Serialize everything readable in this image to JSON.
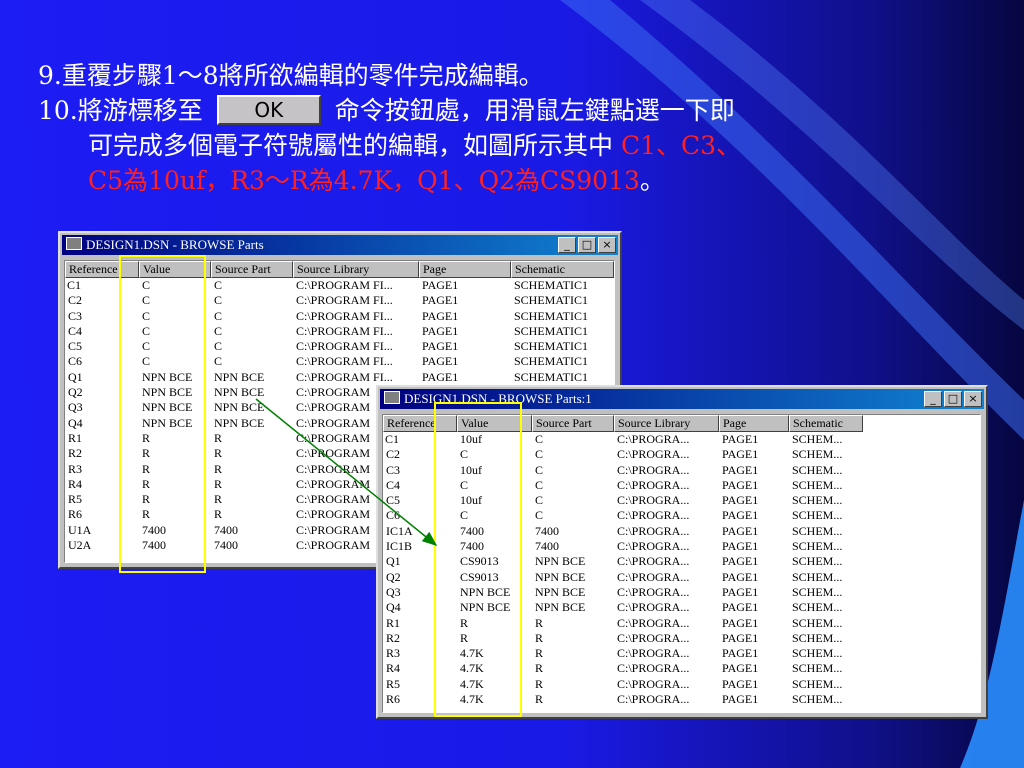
{
  "slide": {
    "line1": "9.重覆步驟1～8將所欲編輯的零件完成編輯。",
    "line2_pre": "10.將游標移至",
    "ok_button": "OK",
    "line2_post": "命令按鈕處，用滑鼠左鍵點選一下即",
    "line3_plain": "可完成多個電子符號屬性的編輯，如圖所示其中",
    "line3_red": "C1、C3、",
    "line4_red": "C5為10uf，R3～R為4.7K，Q1、Q2為CS9013",
    "line4_end": "。"
  },
  "window1": {
    "title": "DESIGN1.DSN - BROWSE Parts",
    "controls": [
      "_",
      "□",
      "×"
    ],
    "columns": [
      "Reference",
      "Value",
      "Source Part",
      "Source Library",
      "Page",
      "Schematic"
    ],
    "rows": [
      [
        "C1",
        "C",
        "C",
        "C:\\PROGRAM FI...",
        "PAGE1",
        "SCHEMATIC1"
      ],
      [
        "C2",
        "C",
        "C",
        "C:\\PROGRAM FI...",
        "PAGE1",
        "SCHEMATIC1"
      ],
      [
        "C3",
        "C",
        "C",
        "C:\\PROGRAM FI...",
        "PAGE1",
        "SCHEMATIC1"
      ],
      [
        "C4",
        "C",
        "C",
        "C:\\PROGRAM FI...",
        "PAGE1",
        "SCHEMATIC1"
      ],
      [
        "C5",
        "C",
        "C",
        "C:\\PROGRAM FI...",
        "PAGE1",
        "SCHEMATIC1"
      ],
      [
        "C6",
        "C",
        "C",
        "C:\\PROGRAM FI...",
        "PAGE1",
        "SCHEMATIC1"
      ],
      [
        "Q1",
        "NPN BCE",
        "NPN BCE",
        "C:\\PROGRAM FI...",
        "PAGE1",
        "SCHEMATIC1"
      ],
      [
        "Q2",
        "NPN BCE",
        "NPN BCE",
        "C:\\PROGRAM",
        "",
        ""
      ],
      [
        "Q3",
        "NPN BCE",
        "NPN BCE",
        "C:\\PROGRAM",
        "",
        ""
      ],
      [
        "Q4",
        "NPN BCE",
        "NPN BCE",
        "C:\\PROGRAM",
        "",
        ""
      ],
      [
        "R1",
        "R",
        "R",
        "C:\\PROGRAM",
        "",
        ""
      ],
      [
        "R2",
        "R",
        "R",
        "C:\\PROGRAM",
        "",
        ""
      ],
      [
        "R3",
        "R",
        "R",
        "C:\\PROGRAM",
        "",
        ""
      ],
      [
        "R4",
        "R",
        "R",
        "C:\\PROGRAM",
        "",
        ""
      ],
      [
        "R5",
        "R",
        "R",
        "C:\\PROGRAM",
        "",
        ""
      ],
      [
        "R6",
        "R",
        "R",
        "C:\\PROGRAM",
        "",
        ""
      ],
      [
        "U1A",
        "7400",
        "7400",
        "C:\\PROGRAM",
        "",
        ""
      ],
      [
        "U2A",
        "7400",
        "7400",
        "C:\\PROGRAM",
        "",
        ""
      ]
    ]
  },
  "window2": {
    "title": "DESIGN1.DSN - BROWSE Parts:1",
    "controls": [
      "_",
      "□",
      "×"
    ],
    "columns": [
      "Reference",
      "Value",
      "Source Part",
      "Source Library",
      "Page",
      "Schematic"
    ],
    "rows": [
      [
        "C1",
        "10uf",
        "C",
        "C:\\PROGRA...",
        "PAGE1",
        "SCHEM..."
      ],
      [
        "C2",
        "C",
        "C",
        "C:\\PROGRA...",
        "PAGE1",
        "SCHEM..."
      ],
      [
        "C3",
        "10uf",
        "C",
        "C:\\PROGRA...",
        "PAGE1",
        "SCHEM..."
      ],
      [
        "C4",
        "C",
        "C",
        "C:\\PROGRA...",
        "PAGE1",
        "SCHEM..."
      ],
      [
        "C5",
        "10uf",
        "C",
        "C:\\PROGRA...",
        "PAGE1",
        "SCHEM..."
      ],
      [
        "C6",
        "C",
        "C",
        "C:\\PROGRA...",
        "PAGE1",
        "SCHEM..."
      ],
      [
        "IC1A",
        "7400",
        "7400",
        "C:\\PROGRA...",
        "PAGE1",
        "SCHEM..."
      ],
      [
        "IC1B",
        "7400",
        "7400",
        "C:\\PROGRA...",
        "PAGE1",
        "SCHEM..."
      ],
      [
        "Q1",
        "CS9013",
        "NPN BCE",
        "C:\\PROGRA...",
        "PAGE1",
        "SCHEM..."
      ],
      [
        "Q2",
        "CS9013",
        "NPN BCE",
        "C:\\PROGRA...",
        "PAGE1",
        "SCHEM..."
      ],
      [
        "Q3",
        "NPN BCE",
        "NPN BCE",
        "C:\\PROGRA...",
        "PAGE1",
        "SCHEM..."
      ],
      [
        "Q4",
        "NPN BCE",
        "NPN BCE",
        "C:\\PROGRA...",
        "PAGE1",
        "SCHEM..."
      ],
      [
        "R1",
        "R",
        "R",
        "C:\\PROGRA...",
        "PAGE1",
        "SCHEM..."
      ],
      [
        "R2",
        "R",
        "R",
        "C:\\PROGRA...",
        "PAGE1",
        "SCHEM..."
      ],
      [
        "R3",
        "4.7K",
        "R",
        "C:\\PROGRA...",
        "PAGE1",
        "SCHEM..."
      ],
      [
        "R4",
        "4.7K",
        "R",
        "C:\\PROGRA...",
        "PAGE1",
        "SCHEM..."
      ],
      [
        "R5",
        "4.7K",
        "R",
        "C:\\PROGRA...",
        "PAGE1",
        "SCHEM..."
      ],
      [
        "R6",
        "4.7K",
        "R",
        "C:\\PROGRA...",
        "PAGE1",
        "SCHEM..."
      ]
    ]
  },
  "colors": {
    "background": "#1a1ae6",
    "text": "#ffffff",
    "highlight_text": "#ff2020",
    "highlight_box": "#ffff00",
    "arrow": "#008000"
  }
}
